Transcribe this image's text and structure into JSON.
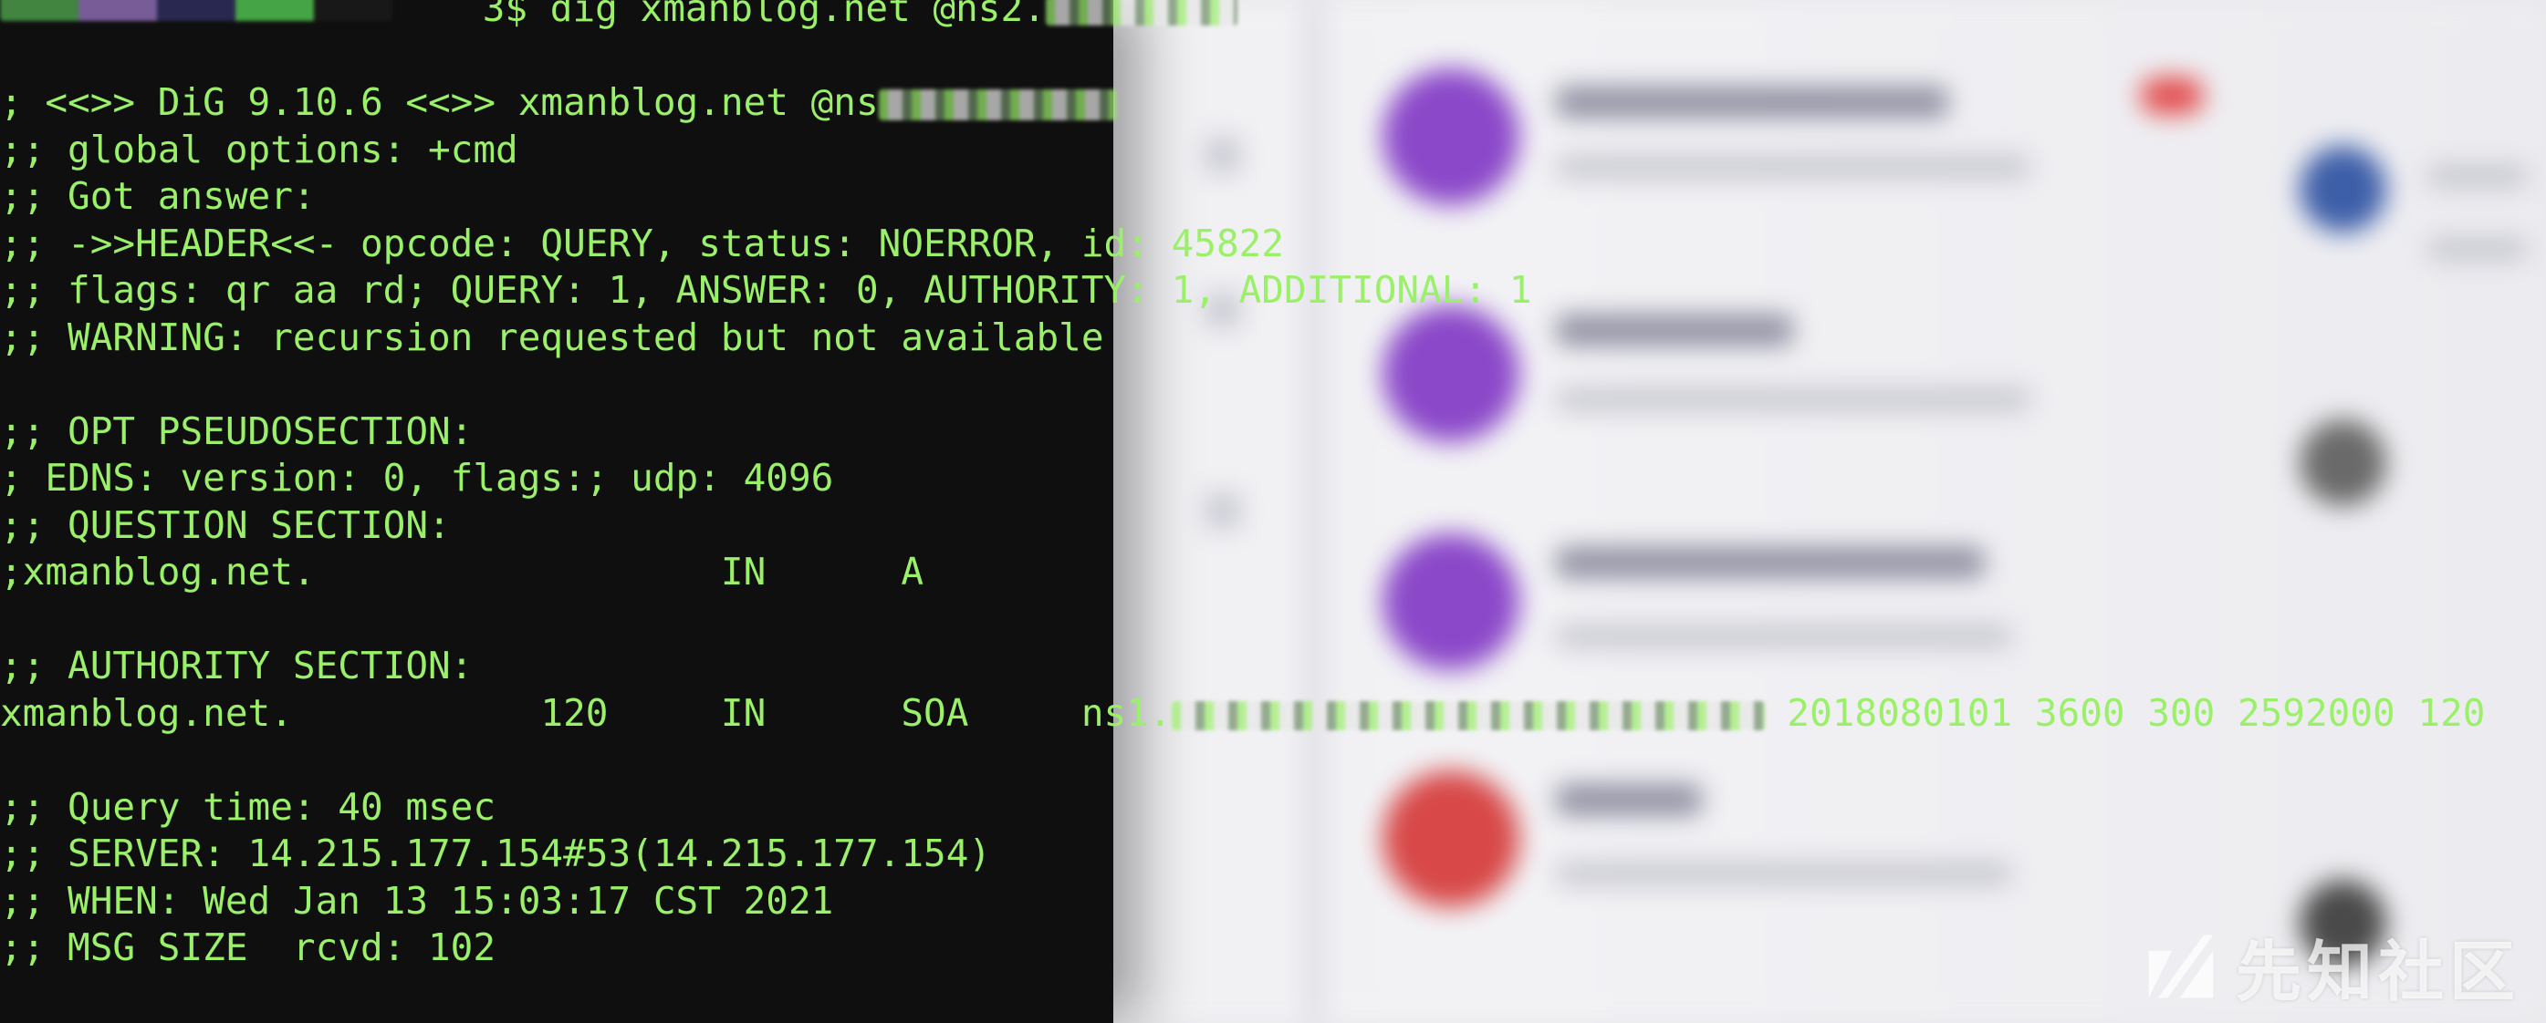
{
  "terminal": {
    "prompt_suffix": "3$",
    "command": " dig xmanblog.net @ns2.",
    "lines": [
      "; <<>> DiG 9.10.6 <<>> xmanblog.net @ns",
      ";; global options: +cmd",
      ";; Got answer:",
      ";; ->>HEADER<<- opcode: QUERY, status: NOERROR, id: 45822",
      ";; flags: qr aa rd; QUERY: 1, ANSWER: 0, AUTHORITY: 1, ADDITIONAL: 1",
      ";; WARNING: recursion requested but not available",
      "",
      ";; OPT PSEUDOSECTION:",
      "; EDNS: version: 0, flags:; udp: 4096",
      ";; QUESTION SECTION:",
      ";xmanblog.net.                  IN      A",
      "",
      ";; AUTHORITY SECTION:",
      "xmanblog.net.           120     IN      SOA     ns1."
    ],
    "soa_tail": " 2018080101 3600 300 2592000 120",
    "footer_lines": [
      "",
      ";; Query time: 40 msec",
      ";; SERVER: 14.215.177.154#53(14.215.177.154)",
      ";; WHEN: Wed Jan 13 15:03:17 CST 2021",
      ";; MSG SIZE  rcvd: 102"
    ]
  },
  "watermark": {
    "text": "先知社区"
  },
  "colors": {
    "terminal_bg": "#0f0f0f",
    "terminal_fg": "#9bf06a"
  }
}
